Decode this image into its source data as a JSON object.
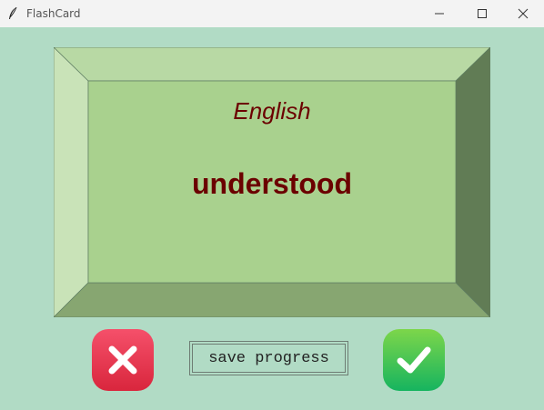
{
  "window": {
    "title": "FlashCard",
    "icons": {
      "app": "feather-icon",
      "minimize": "minimize-icon",
      "maximize": "maximize-icon",
      "close": "close-icon"
    }
  },
  "card": {
    "language": "English",
    "word": "understood",
    "colors": {
      "face": "#a9d18e",
      "top": "#b8d9a4",
      "left": "#c9e3b8",
      "right": "#617c55",
      "bottom": "#87a671",
      "text": "#6b0000"
    }
  },
  "controls": {
    "wrong_icon": "cross-icon",
    "right_icon": "checkmark-icon",
    "save_label": "save progress"
  },
  "colors": {
    "background": "#b1dbc5"
  }
}
